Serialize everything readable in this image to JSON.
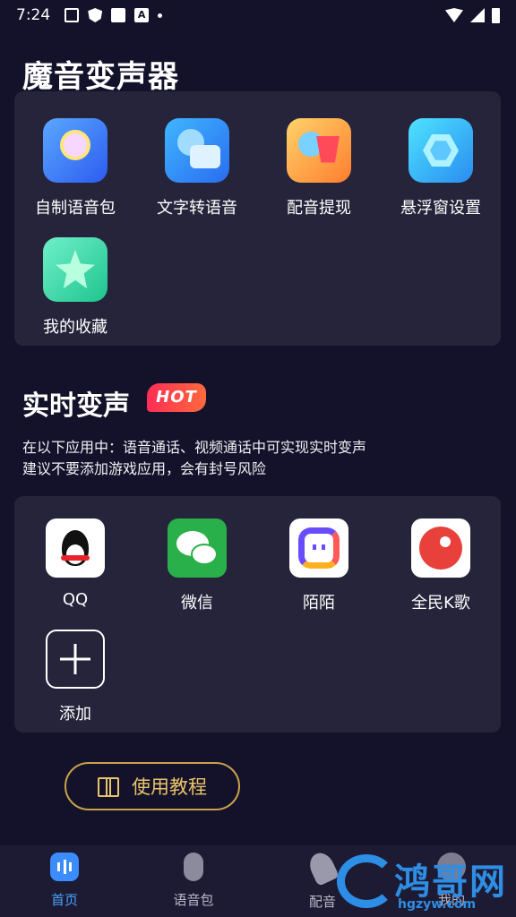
{
  "status_bar": {
    "time": "7:24",
    "icons": [
      "image-icon",
      "shield-x-icon",
      "square-icon",
      "a-icon",
      "dot-icon",
      "wifi-icon",
      "signal-icon",
      "battery-icon"
    ]
  },
  "page_title": "魔音变声器",
  "tools": [
    {
      "label": "自制语音包",
      "icon": "lollipop-mic-icon"
    },
    {
      "label": "文字转语音",
      "icon": "mic-card-icon"
    },
    {
      "label": "配音提现",
      "icon": "mic-cup-icon"
    },
    {
      "label": "悬浮窗设置",
      "icon": "hexagon-icon"
    },
    {
      "label": "我的收藏",
      "icon": "star-icon"
    }
  ],
  "realtime": {
    "title": "实时变声",
    "badge": "HOT",
    "desc_line1": "在以下应用中：语音通话、视频通话中可实现实时变声",
    "desc_line2": "建议不要添加游戏应用，会有封号风险"
  },
  "apps": [
    {
      "label": "QQ",
      "icon": "qq-icon"
    },
    {
      "label": "微信",
      "icon": "wechat-icon"
    },
    {
      "label": "陌陌",
      "icon": "momo-icon"
    },
    {
      "label": "全民K歌",
      "icon": "kge-icon"
    },
    {
      "label": "添加",
      "icon": "plus-icon"
    }
  ],
  "tutorial_button": {
    "label": "使用教程",
    "icon": "book-icon"
  },
  "bottom_nav": [
    {
      "label": "首页",
      "active": true,
      "icon": "home-icon"
    },
    {
      "label": "语音包",
      "active": false,
      "icon": "microphone-icon"
    },
    {
      "label": "配音",
      "active": false,
      "icon": "handheld-mic-icon"
    },
    {
      "label": "我的",
      "active": false,
      "icon": "profile-icon"
    }
  ],
  "watermark": {
    "text": "鸿哥网",
    "url": "hgzyw.com"
  },
  "colors": {
    "background": "#13122a",
    "card": "#25243a",
    "accent_blue": "#4aa3ff",
    "gold": "#e9c46a",
    "hot_red": "#ff2d55"
  }
}
